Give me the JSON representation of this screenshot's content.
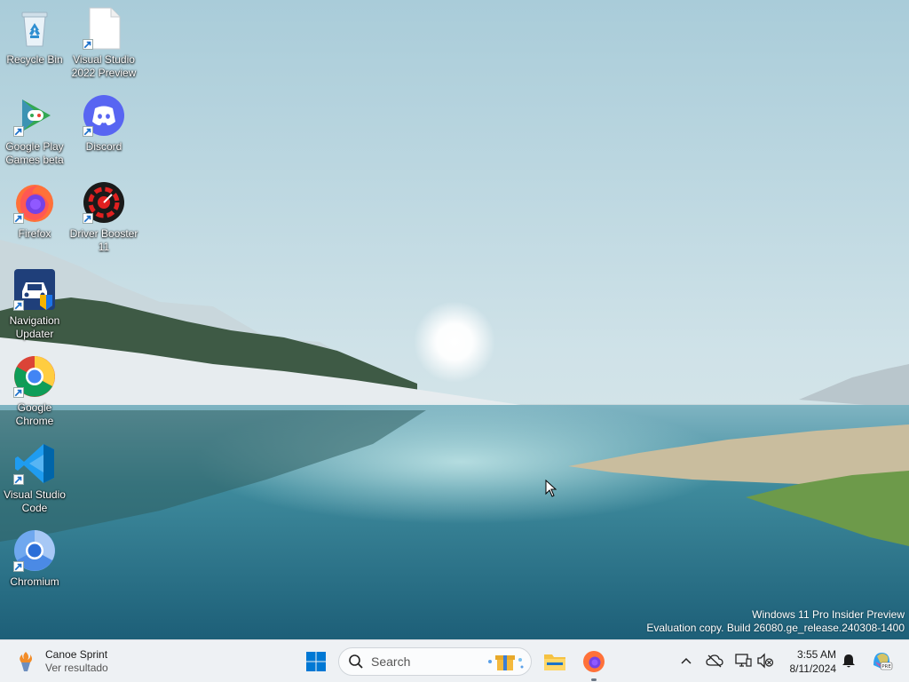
{
  "desktop": {
    "icons": [
      {
        "label": "Recycle Bin",
        "icon": "recycle-bin-icon"
      },
      {
        "label": "Visual Studio 2022 Preview",
        "icon": "file-icon"
      },
      {
        "label": "Google Play Games beta",
        "icon": "google-play-games-icon"
      },
      {
        "label": "Discord",
        "icon": "discord-icon"
      },
      {
        "label": "Firefox",
        "icon": "firefox-icon"
      },
      {
        "label": "Driver Booster 11",
        "icon": "driver-booster-icon"
      },
      {
        "label": "Navigation Updater",
        "icon": "navigation-updater-icon"
      },
      {
        "label": "Google Chrome",
        "icon": "chrome-icon"
      },
      {
        "label": "Visual Studio Code",
        "icon": "vscode-icon"
      },
      {
        "label": "Chromium",
        "icon": "chromium-icon"
      }
    ]
  },
  "watermark": {
    "line1": "Windows 11 Pro Insider Preview",
    "line2": "Evaluation copy. Build 26080.ge_release.240308-1400"
  },
  "taskbar": {
    "widget": {
      "title": "Canoe Sprint",
      "subtitle": "Ver resultado"
    },
    "search": {
      "placeholder": "Search"
    },
    "clock": {
      "time": "3:55 AM",
      "date": "8/11/2024"
    }
  },
  "colors": {
    "taskbar_bg": "#eef1f4",
    "windows_blue": "#0078d4",
    "discord": "#5865f2"
  }
}
